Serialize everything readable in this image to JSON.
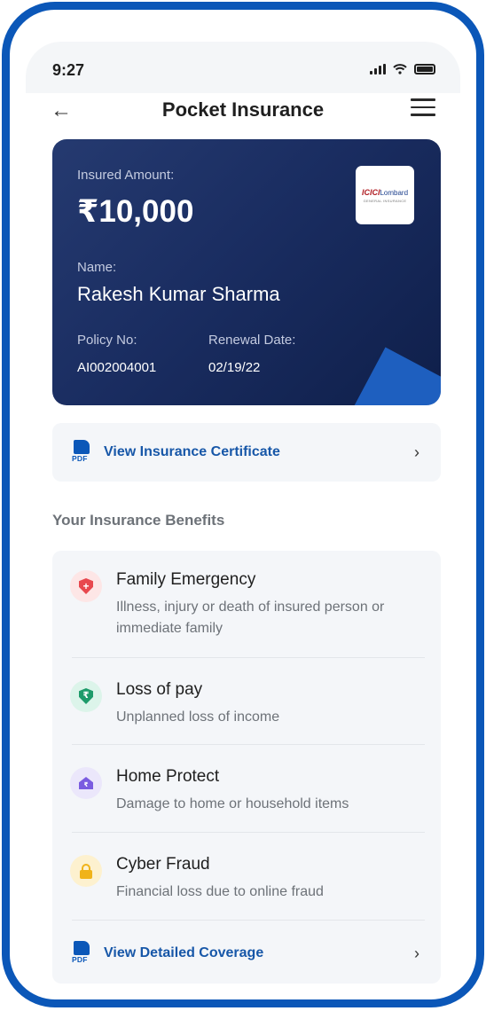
{
  "status_bar": {
    "time": "9:27"
  },
  "header": {
    "title": "Pocket Insurance",
    "back_label": "←"
  },
  "card": {
    "insured_amount_label": "Insured Amount:",
    "insured_amount": "₹10,000",
    "name_label": "Name:",
    "name": "Rakesh Kumar Sharma",
    "policy_label": "Policy No:",
    "policy_no": "AI002004001",
    "renewal_label": "Renewal Date:",
    "renewal_date": "02/19/22",
    "insurer_logo_text": "ICICI",
    "insurer_logo_text2": "Lombard",
    "insurer_logo_sub": "GENERAL INSURANCE"
  },
  "certificate_link": {
    "label": "View Insurance Certificate",
    "pdf_badge": "PDF",
    "chevron": "›"
  },
  "benefits": {
    "section_title": "Your Insurance Benefits",
    "items": [
      {
        "title": "Family Emergency",
        "description": "Illness, injury or death of insured person or immediate family",
        "icon": "red-shield-plus-icon",
        "glyph": "+"
      },
      {
        "title": "Loss of pay",
        "description": "Unplanned loss of income",
        "icon": "green-shield-rupee-icon",
        "glyph": "₹"
      },
      {
        "title": "Home Protect",
        "description": "Damage to home or household items",
        "icon": "purple-home-icon",
        "glyph": "₹"
      },
      {
        "title": "Cyber Fraud",
        "description": "Financial loss due to online fraud",
        "icon": "yellow-lock-icon"
      }
    ],
    "detail_link": {
      "label": "View Detailed Coverage",
      "pdf_badge": "PDF",
      "chevron": "›"
    }
  },
  "colors": {
    "frame": "#0b57b8",
    "card_dark": "#1a2d61",
    "link": "#1757a8"
  }
}
